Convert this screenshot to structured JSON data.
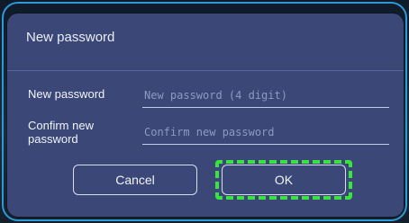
{
  "dialog": {
    "title": "New password",
    "fields": [
      {
        "label": "New password",
        "placeholder": "New password (4 digit)",
        "value": ""
      },
      {
        "label": "Confirm new password",
        "placeholder": "Confirm new password",
        "value": ""
      }
    ],
    "buttons": {
      "cancel_label": "Cancel",
      "ok_label": "OK"
    },
    "focused_button": "OK"
  },
  "colors": {
    "dialog_background": "#3a4777",
    "focus_ring": "#39e43c",
    "frame_accent": "#2f98d8"
  }
}
